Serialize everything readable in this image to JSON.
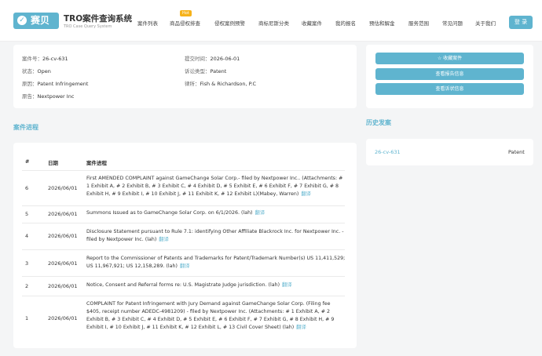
{
  "header": {
    "logo_text": "赛贝",
    "brand_title": "TRO案件查询系统",
    "brand_subtitle": "TRO Case Query System",
    "nav": [
      "案件列表",
      "商品侵权排查",
      "侵权案例预警",
      "商标尼斯分类",
      "收藏案件",
      "我的报名",
      "预估和解金",
      "服务范围",
      "常见问题",
      "关于我们"
    ],
    "hot_badge": "Hot",
    "login_label": "登 录"
  },
  "case_info": {
    "case_no_label": "案件号：",
    "case_no": "26-cv-631",
    "submit_label": "提交时间：",
    "submit_time": "2026-06-01",
    "status_label": "状态：",
    "status": "Open",
    "type_label": "诉讼类型：",
    "type": "Patent",
    "cause_label": "原因：",
    "cause": "Patent Infringement",
    "firm_label": "律所：",
    "firm": "Fish & Richardson, P.C",
    "plaintiff_label": "原告：",
    "plaintiff": "Nextpower Inc"
  },
  "actions": {
    "favorite": "☆ 收藏案件",
    "view_report": "查看报告信息",
    "view_complaint": "查看诉状信息"
  },
  "history": {
    "title": "历史发案",
    "items": [
      {
        "id": "26-cv-631",
        "type": "Patent"
      }
    ]
  },
  "progress": {
    "title": "案件进程",
    "headers": {
      "num": "#",
      "date": "日期",
      "content": "案件进程"
    },
    "translate_label": "翻译",
    "rows": [
      {
        "num": "6",
        "date": "2026/06/01",
        "text": "First AMENDED COMPLAINT against GameChange Solar Corp.- filed by Nextpower Inc.. (Attachments: # 1 Exhibit A, # 2 Exhibit B, # 3 Exhibit C, # 4 Exhibit D, # 5 Exhibit E, # 6 Exhibit F, # 7 Exhibit G, # 8 Exhibit H, # 9 Exhibit I, # 10 Exhibit J, # 11 Exhibit K, # 12 Exhibit L)(Mabey, Warren)"
      },
      {
        "num": "5",
        "date": "2026/06/01",
        "text": "Summons Issued as to GameChange Solar Corp. on 6/1/2026. (lah)"
      },
      {
        "num": "4",
        "date": "2026/06/01",
        "text": "Disclosure Statement pursuant to Rule 7.1: identifying Other Affiliate Blackrock Inc. for Nextpower Inc. - filed by Nextpower Inc. (lah)"
      },
      {
        "num": "3",
        "date": "2026/06/01",
        "text": "Report to the Commissioner of Patents and Trademarks for Patent/Trademark Number(s) US 11,411,529; US 11,967,921; US 12,158,289. (lah)"
      },
      {
        "num": "2",
        "date": "2026/06/01",
        "text": "Notice, Consent and Referral forms re: U.S. Magistrate Judge jurisdiction. (lah)"
      },
      {
        "num": "1",
        "date": "2026/06/01",
        "text": "COMPLAINT for Patent Infringement with Jury Demand against GameChange Solar Corp. (Filing fee $405, receipt number ADEDC-4981209) - filed by Nextpower Inc. (Attachments: # 1 Exhibit A, # 2 Exhibit B, # 3 Exhibit C, # 4 Exhibit D, # 5 Exhibit E, # 6 Exhibit F, # 7 Exhibit G, # 8 Exhibit H, # 9 Exhibit I, # 10 Exhibit J, # 11 Exhibit K, # 12 Exhibit L, # 13 Civil Cover Sheet) (lah)"
      }
    ]
  }
}
